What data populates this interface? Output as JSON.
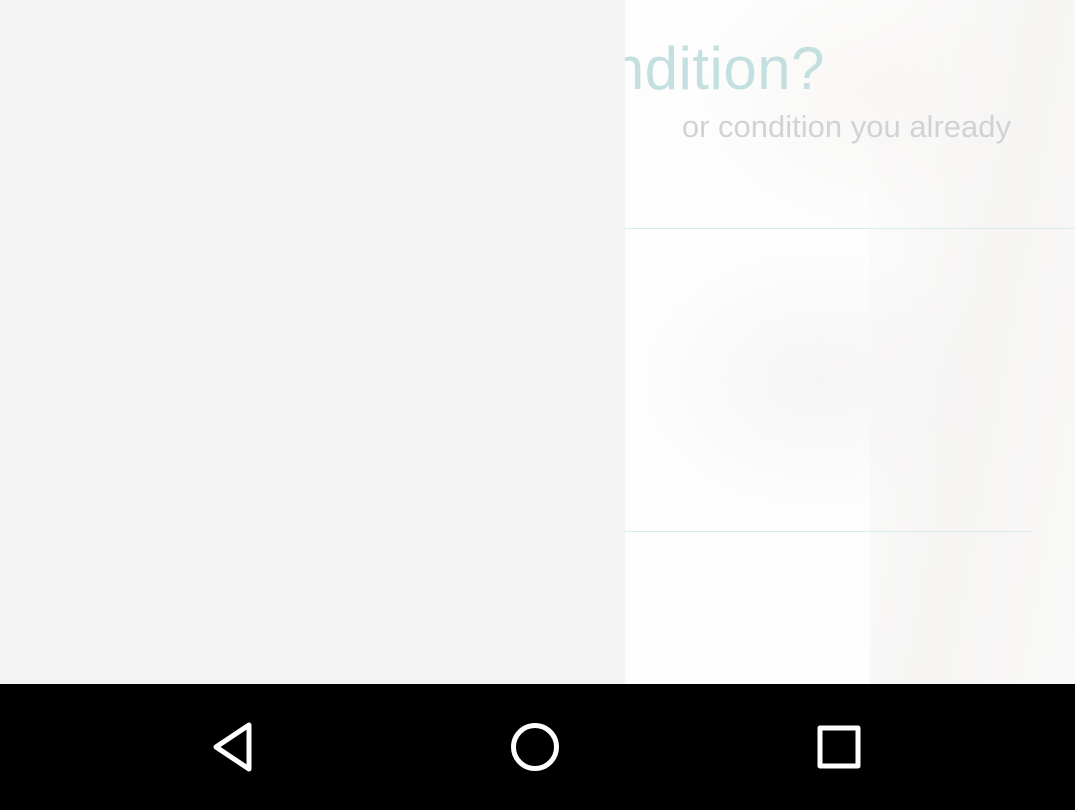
{
  "screen": {
    "title_fragment": "ndition?",
    "subtitle_fragment": "or condition you already"
  },
  "nav_bar": {
    "background": "#000000",
    "icon_color": "#ffffff",
    "buttons": [
      {
        "icon": "back-triangle-icon"
      },
      {
        "icon": "home-circle-icon"
      },
      {
        "icon": "recents-square-icon"
      }
    ]
  },
  "colors": {
    "title": "#c4dfe0",
    "subtitle": "#cfd3d4",
    "divider": "#d8ecec",
    "drawer": "#f3f3f3"
  }
}
